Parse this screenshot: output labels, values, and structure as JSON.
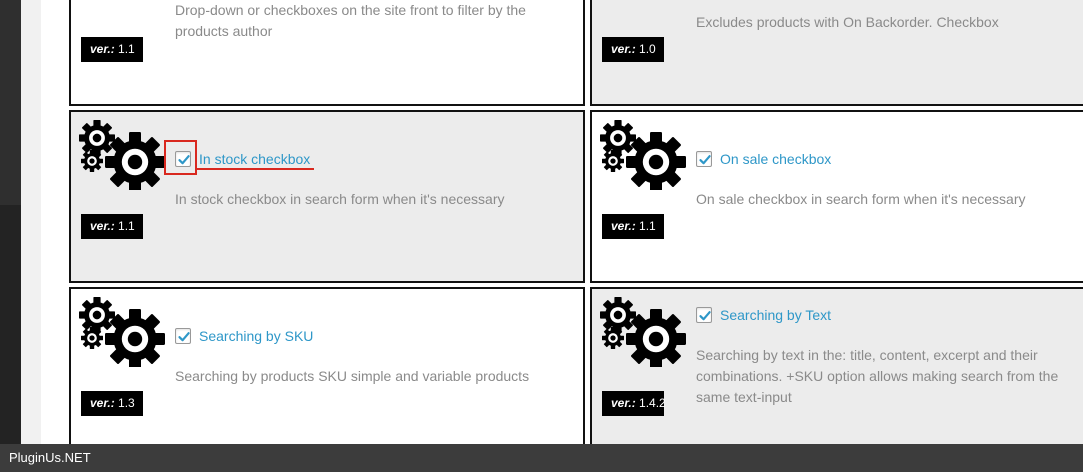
{
  "colors": {
    "accent": "#2e97c8",
    "highlight": "#d9281f",
    "version_badge": "#000000"
  },
  "cards": [
    {
      "title": "",
      "description": "Drop-down or checkboxes on the site front to filter by the products author",
      "version_label": "ver.:",
      "version": "1.1",
      "icon": "gears-icon"
    },
    {
      "title": "",
      "description": "Excludes products with On Backorder. Checkbox",
      "version_label": "ver.:",
      "version": "1.0",
      "icon": "gears-icon"
    },
    {
      "title": "In stock checkbox",
      "checked": true,
      "description": "In stock checkbox in search form when it's necessary",
      "version_label": "ver.:",
      "version": "1.1",
      "icon": "gears-icon"
    },
    {
      "title": "On sale checkbox",
      "checked": true,
      "description": "On sale checkbox in search form when it's necessary",
      "version_label": "ver.:",
      "version": "1.1",
      "icon": "gears-icon"
    },
    {
      "title": "Searching by SKU",
      "checked": true,
      "description": "Searching by products SKU simple and variable products",
      "version_label": "ver.:",
      "version": "1.3",
      "icon": "gears-icon"
    },
    {
      "title": "Searching by Text",
      "checked": true,
      "description": "Searching by text in the: title, content, excerpt and their combinations. +SKU option allows making search from the same text-input",
      "version_label": "ver.:",
      "version": "1.4.2",
      "icon": "gears-icon"
    }
  ],
  "footer": {
    "watermark": "PluginUs.NET"
  }
}
